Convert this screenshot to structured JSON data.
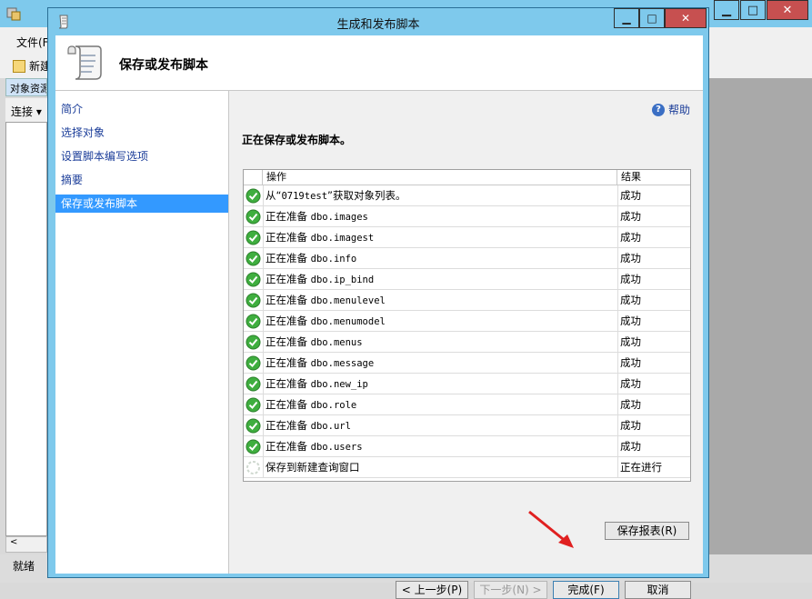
{
  "background_app": {
    "menu_file": "文件(F",
    "toolbar_new": "新建",
    "object_explorer": "对象资源",
    "connect": "连接 ▾",
    "status": "就绪",
    "scroll_left": "<"
  },
  "dialog": {
    "title": "生成和发布脚本",
    "header_title": "保存或发布脚本",
    "nav": [
      {
        "label": "简介",
        "selected": false
      },
      {
        "label": "选择对象",
        "selected": false
      },
      {
        "label": "设置脚本编写选项",
        "selected": false
      },
      {
        "label": "摘要",
        "selected": false
      },
      {
        "label": "保存或发布脚本",
        "selected": true
      }
    ],
    "help": "帮助",
    "status_line": "正在保存或发布脚本。",
    "grid": {
      "col_operation": "操作",
      "col_result": "结果",
      "rows": [
        {
          "prefix": "从“",
          "obj": "0719test",
          "suffix": "”获取对象列表。",
          "result": "成功",
          "status": "success"
        },
        {
          "prefix": "正在准备 ",
          "obj": "dbo.images",
          "suffix": "",
          "result": "成功",
          "status": "success"
        },
        {
          "prefix": "正在准备 ",
          "obj": "dbo.imagest",
          "suffix": "",
          "result": "成功",
          "status": "success"
        },
        {
          "prefix": "正在准备 ",
          "obj": "dbo.info",
          "suffix": "",
          "result": "成功",
          "status": "success"
        },
        {
          "prefix": "正在准备 ",
          "obj": "dbo.ip_bind",
          "suffix": "",
          "result": "成功",
          "status": "success"
        },
        {
          "prefix": "正在准备 ",
          "obj": "dbo.menulevel",
          "suffix": "",
          "result": "成功",
          "status": "success"
        },
        {
          "prefix": "正在准备 ",
          "obj": "dbo.menumodel",
          "suffix": "",
          "result": "成功",
          "status": "success"
        },
        {
          "prefix": "正在准备 ",
          "obj": "dbo.menus",
          "suffix": "",
          "result": "成功",
          "status": "success"
        },
        {
          "prefix": "正在准备 ",
          "obj": "dbo.message",
          "suffix": "",
          "result": "成功",
          "status": "success"
        },
        {
          "prefix": "正在准备 ",
          "obj": "dbo.new_ip",
          "suffix": "",
          "result": "成功",
          "status": "success"
        },
        {
          "prefix": "正在准备 ",
          "obj": "dbo.role",
          "suffix": "",
          "result": "成功",
          "status": "success"
        },
        {
          "prefix": "正在准备 ",
          "obj": "dbo.url",
          "suffix": "",
          "result": "成功",
          "status": "success"
        },
        {
          "prefix": "正在准备 ",
          "obj": "dbo.users",
          "suffix": "",
          "result": "成功",
          "status": "success"
        },
        {
          "prefix": "保存到新建查询窗口",
          "obj": "",
          "suffix": "",
          "result": "正在进行",
          "status": "in-progress"
        }
      ]
    },
    "buttons": {
      "save_report": "保存报表(R)",
      "previous": "< 上一步(P)",
      "next": "下一步(N) >",
      "finish": "完成(F)",
      "cancel": "取消"
    },
    "colors": {
      "titlebar": "#7ec9ec",
      "selected_nav": "#3399ff",
      "success_icon": "#3fae3f",
      "close_button": "#c75050",
      "annotation_arrow": "#e02020"
    }
  }
}
